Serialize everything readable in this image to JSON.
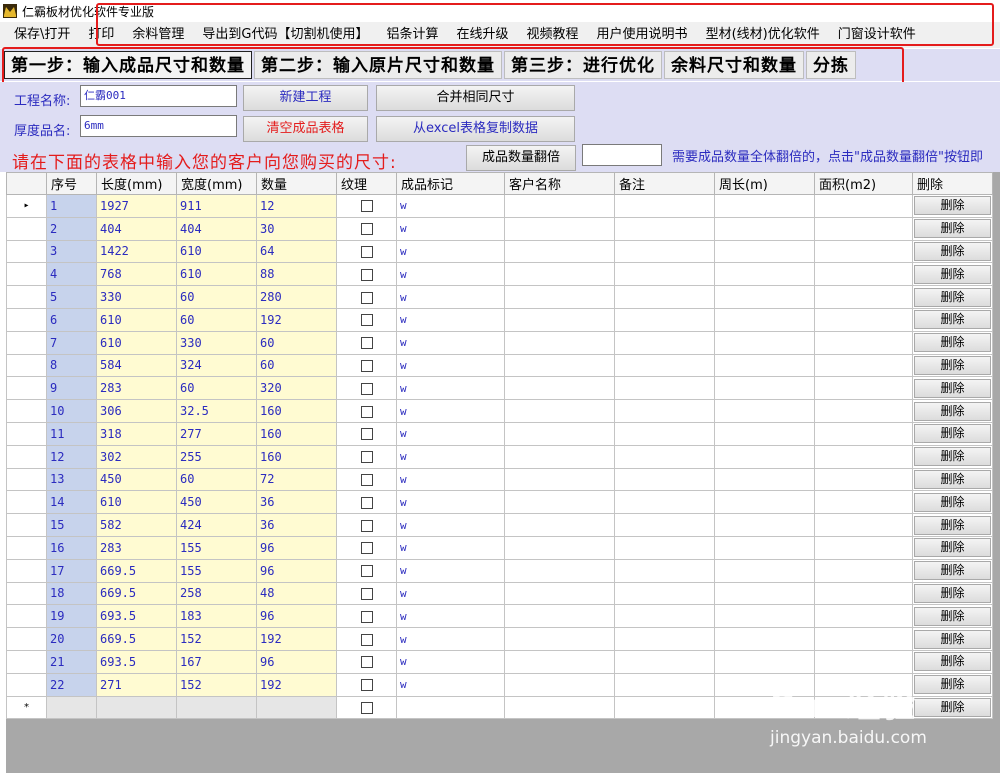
{
  "window": {
    "title": "仁霸板材优化软件专业版",
    "logo_icon": "crown-logo-icon"
  },
  "menu": [
    "保存\\打开",
    "打印",
    "余料管理",
    "导出到G代码【切割机使用】",
    "铝条计算",
    "在线升级",
    "视频教程",
    "用户使用说明书",
    "型材(线材)优化软件",
    "门窗设计软件"
  ],
  "steps": [
    {
      "label": "第一步：输入成品尺寸和数量",
      "active": true
    },
    {
      "label": "第二步：输入原片尺寸和数量",
      "active": false
    },
    {
      "label": "第三步：进行优化",
      "active": false
    },
    {
      "label": "余料尺寸和数量",
      "active": false
    },
    {
      "label": "分拣",
      "active": false
    }
  ],
  "form": {
    "project_name_label": "工程名称:",
    "project_name_value": "仁霸001",
    "thickness_label": "厚度品名:",
    "thickness_value": "6mm",
    "new_project_button": "新建工程",
    "merge_button": "合并相同尺寸",
    "clear_button": "清空成品表格",
    "excel_button": "从excel表格复制数据",
    "instruction": "请在下面的表格中输入您的客户向您购买的尺寸:",
    "multiply_button": "成品数量翻倍",
    "multiply_value": "",
    "hint": "需要成品数量全体翻倍的，点击\"成品数量翻倍\"按钮即"
  },
  "table": {
    "columns": [
      "序号",
      "长度(mm)",
      "宽度(mm)",
      "数量",
      "纹理",
      "成品标记",
      "客户名称",
      "备注",
      "周长(m)",
      "面积(m2)",
      "删除"
    ],
    "delete_label": "删除",
    "current_row_marker": "▸",
    "new_row_marker": "*",
    "rows": [
      {
        "seq": "1",
        "length": "1927",
        "width": "911",
        "qty": "12",
        "mark": "w"
      },
      {
        "seq": "2",
        "length": "404",
        "width": "404",
        "qty": "30",
        "mark": "w"
      },
      {
        "seq": "3",
        "length": "1422",
        "width": "610",
        "qty": "64",
        "mark": "w"
      },
      {
        "seq": "4",
        "length": "768",
        "width": "610",
        "qty": "88",
        "mark": "w"
      },
      {
        "seq": "5",
        "length": "330",
        "width": "60",
        "qty": "280",
        "mark": "w"
      },
      {
        "seq": "6",
        "length": "610",
        "width": "60",
        "qty": "192",
        "mark": "w"
      },
      {
        "seq": "7",
        "length": "610",
        "width": "330",
        "qty": "60",
        "mark": "w"
      },
      {
        "seq": "8",
        "length": "584",
        "width": "324",
        "qty": "60",
        "mark": "w"
      },
      {
        "seq": "9",
        "length": "283",
        "width": "60",
        "qty": "320",
        "mark": "w"
      },
      {
        "seq": "10",
        "length": "306",
        "width": "32.5",
        "qty": "160",
        "mark": "w"
      },
      {
        "seq": "11",
        "length": "318",
        "width": "277",
        "qty": "160",
        "mark": "w"
      },
      {
        "seq": "12",
        "length": "302",
        "width": "255",
        "qty": "160",
        "mark": "w"
      },
      {
        "seq": "13",
        "length": "450",
        "width": "60",
        "qty": "72",
        "mark": "w"
      },
      {
        "seq": "14",
        "length": "610",
        "width": "450",
        "qty": "36",
        "mark": "w"
      },
      {
        "seq": "15",
        "length": "582",
        "width": "424",
        "qty": "36",
        "mark": "w"
      },
      {
        "seq": "16",
        "length": "283",
        "width": "155",
        "qty": "96",
        "mark": "w"
      },
      {
        "seq": "17",
        "length": "669.5",
        "width": "155",
        "qty": "96",
        "mark": "w"
      },
      {
        "seq": "18",
        "length": "669.5",
        "width": "258",
        "qty": "48",
        "mark": "w"
      },
      {
        "seq": "19",
        "length": "693.5",
        "width": "183",
        "qty": "96",
        "mark": "w"
      },
      {
        "seq": "20",
        "length": "669.5",
        "width": "152",
        "qty": "192",
        "mark": "w"
      },
      {
        "seq": "21",
        "length": "693.5",
        "width": "167",
        "qty": "96",
        "mark": "w"
      },
      {
        "seq": "22",
        "length": "271",
        "width": "152",
        "qty": "192",
        "mark": "w"
      }
    ]
  },
  "watermark": {
    "line1": "Bai 经验",
    "line2": "jingyan.baidu.com"
  },
  "colors": {
    "highlight_red": "#e41c1c",
    "label_blue": "#2b2bbf",
    "panel_lavender": "#ddddf3"
  }
}
